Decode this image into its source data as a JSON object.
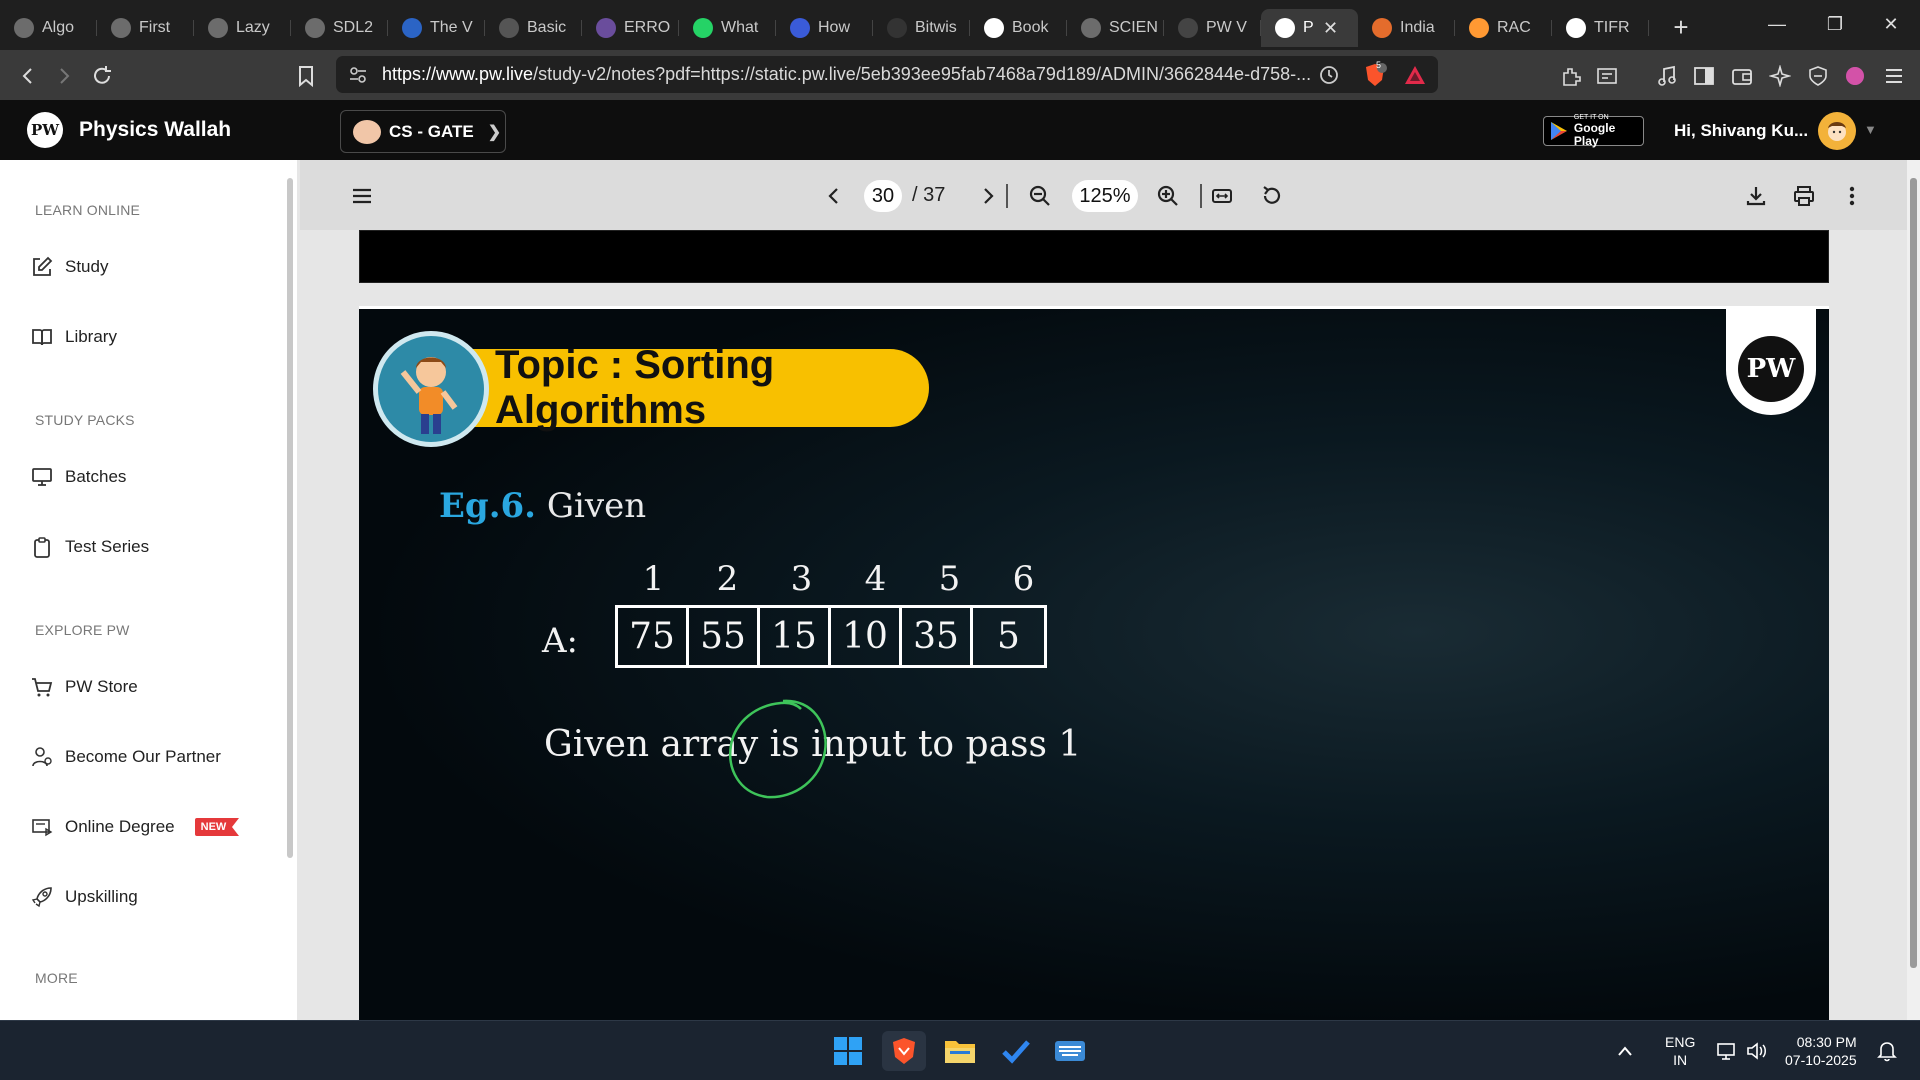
{
  "browser": {
    "tabs": [
      {
        "title": "Algo",
        "color": "#6c6c6c"
      },
      {
        "title": "First",
        "color": "#6c6c6c"
      },
      {
        "title": "Lazy",
        "color": "#6c6c6c"
      },
      {
        "title": "SDL2",
        "color": "#6c6c6c"
      },
      {
        "title": "The V",
        "color": "#2b64c5"
      },
      {
        "title": "Basic",
        "color": "#555555"
      },
      {
        "title": "ERRO",
        "color": "#6a4d9c"
      },
      {
        "title": "What",
        "color": "#25d366"
      },
      {
        "title": "How",
        "color": "#3a5bd8"
      },
      {
        "title": "Bitwis",
        "color": "#333333"
      },
      {
        "title": "Book",
        "color": "#ffffff"
      },
      {
        "title": "SCIEN",
        "color": "#6c6c6c"
      },
      {
        "title": "PW V",
        "color": "#444444"
      },
      {
        "title": "P",
        "color": "#ffffff",
        "active": true
      },
      {
        "title": "India",
        "color": "#e46c2c"
      },
      {
        "title": "RAC",
        "color": "#ff9933"
      },
      {
        "title": "TIFR",
        "color": "#ffffff"
      }
    ],
    "url_host": "https://www.pw.live",
    "url_rest": "/study-v2/notes?pdf=https://static.pw.live/5eb393ee95fab7468a79d189/ADMIN/3662844e-d758-...",
    "shield_count": "5"
  },
  "header": {
    "brand": "Physics Wallah",
    "logo_text": "PW",
    "batch": "CS - GATE",
    "gplay_small": "GET IT ON",
    "gplay_big": "Google Play",
    "greeting": "Hi, Shivang Ku..."
  },
  "sidebar": {
    "sections": {
      "learn": "LEARN ONLINE",
      "packs": "STUDY PACKS",
      "explore": "EXPLORE PW",
      "more": "MORE"
    },
    "items": {
      "study": "Study",
      "library": "Library",
      "batches": "Batches",
      "test_series": "Test Series",
      "store": "PW Store",
      "partner": "Become Our Partner",
      "degree": "Online Degree",
      "degree_badge": "NEW",
      "upskilling": "Upskilling"
    }
  },
  "pdf": {
    "current_page": "30",
    "total_pages": "/ 37",
    "zoom": "125%"
  },
  "slide": {
    "topic": "Topic : Sorting Algorithms",
    "watermark": "PW",
    "eg_prefix": "Eg.6.",
    "eg_rest": "Given",
    "array_label": "A:",
    "indices": [
      "1",
      "2",
      "3",
      "4",
      "5",
      "6"
    ],
    "values": [
      "75",
      "55",
      "15",
      "10",
      "35",
      "5"
    ],
    "note": "Given array is input to pass 1"
  },
  "taskbar": {
    "lang1": "ENG",
    "lang2": "IN",
    "time": "08:30 PM",
    "date": "07-10-2025"
  }
}
